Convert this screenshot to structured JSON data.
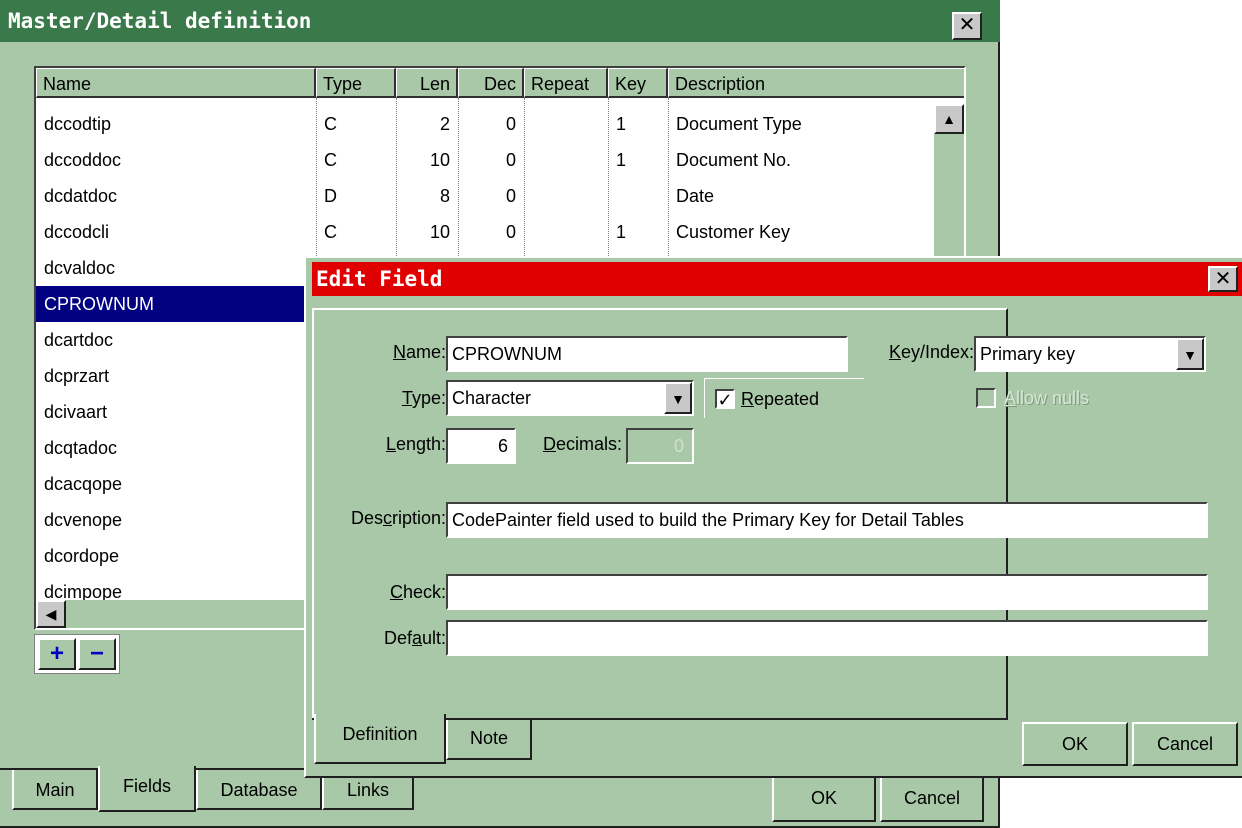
{
  "master": {
    "title": "Master/Detail definition",
    "close_glyph": "✕",
    "columns": [
      "Name",
      "Type",
      "Len",
      "Dec",
      "Repeat",
      "Key",
      "Description"
    ],
    "rows": [
      {
        "name": "dccodtip",
        "type": "C",
        "len": "2",
        "dec": "0",
        "repeat": "",
        "key": "1",
        "desc": "Document Type"
      },
      {
        "name": "dccoddoc",
        "type": "C",
        "len": "10",
        "dec": "0",
        "repeat": "",
        "key": "1",
        "desc": "Document No."
      },
      {
        "name": "dcdatdoc",
        "type": "D",
        "len": "8",
        "dec": "0",
        "repeat": "",
        "key": "",
        "desc": "Date"
      },
      {
        "name": "dccodcli",
        "type": "C",
        "len": "10",
        "dec": "0",
        "repeat": "",
        "key": "1",
        "desc": "Customer Key"
      },
      {
        "name": "dcvaldoc",
        "type": "",
        "len": "",
        "dec": "",
        "repeat": "",
        "key": "",
        "desc": ""
      },
      {
        "name": "CPROWNUM",
        "type": "",
        "len": "",
        "dec": "",
        "repeat": "",
        "key": "",
        "desc": ""
      },
      {
        "name": "dcartdoc",
        "type": "",
        "len": "",
        "dec": "",
        "repeat": "",
        "key": "",
        "desc": ""
      },
      {
        "name": "dcprzart",
        "type": "",
        "len": "",
        "dec": "",
        "repeat": "",
        "key": "",
        "desc": ""
      },
      {
        "name": "dcivaart",
        "type": "",
        "len": "",
        "dec": "",
        "repeat": "",
        "key": "",
        "desc": ""
      },
      {
        "name": "dcqtadoc",
        "type": "",
        "len": "",
        "dec": "",
        "repeat": "",
        "key": "",
        "desc": ""
      },
      {
        "name": "dcacqope",
        "type": "",
        "len": "",
        "dec": "",
        "repeat": "",
        "key": "",
        "desc": ""
      },
      {
        "name": "dcvenope",
        "type": "",
        "len": "",
        "dec": "",
        "repeat": "",
        "key": "",
        "desc": ""
      },
      {
        "name": "dcordope",
        "type": "",
        "len": "",
        "dec": "",
        "repeat": "",
        "key": "",
        "desc": ""
      },
      {
        "name": "dcimpope",
        "type": "",
        "len": "",
        "dec": "",
        "repeat": "",
        "key": "",
        "desc": ""
      }
    ],
    "add_glyph": "+",
    "remove_glyph": "−",
    "tabs": [
      "Main",
      "Fields",
      "Database",
      "Links"
    ],
    "ok_label": "OK",
    "cancel_label": "Cancel"
  },
  "edit": {
    "title": "Edit Field",
    "close_glyph": "✕",
    "name_label_u": "N",
    "name_label_rest": "ame:",
    "name_value": "CPROWNUM",
    "key_label_u": "K",
    "key_label_rest": "ey/Index:",
    "key_value": "Primary key",
    "type_label_u": "T",
    "type_label_rest": "ype:",
    "type_value": "Character",
    "repeated_label_u": "R",
    "repeated_label_rest": "epeated",
    "repeated_checked": "✓",
    "allow_nulls_label_u": "A",
    "allow_nulls_label_rest": "llow nulls",
    "length_label_u": "L",
    "length_label_rest": "ength:",
    "length_value": "6",
    "decimals_label_u": "D",
    "decimals_label_rest": "ecimals:",
    "decimals_value": "0",
    "description_label_pre": "Des",
    "description_label_u": "c",
    "description_label_rest": "ription:",
    "description_value": "CodePainter field used to build the Primary Key for Detail Tables",
    "check_label_u": "C",
    "check_label_rest": "heck:",
    "check_value": "",
    "default_label_pre": "Def",
    "default_label_u": "a",
    "default_label_rest": "ult:",
    "default_value": "",
    "tabs": [
      "Definition",
      "Note"
    ],
    "ok_label": "OK",
    "cancel_label": "Cancel",
    "dropdown_glyph": "▼"
  },
  "scroll": {
    "up_glyph": "▲",
    "left_glyph": "◀"
  },
  "colors": {
    "master_title": "#3a7a4a",
    "edit_title": "#e00000",
    "window_bg": "#a8c8a8",
    "selection": "#000080"
  }
}
